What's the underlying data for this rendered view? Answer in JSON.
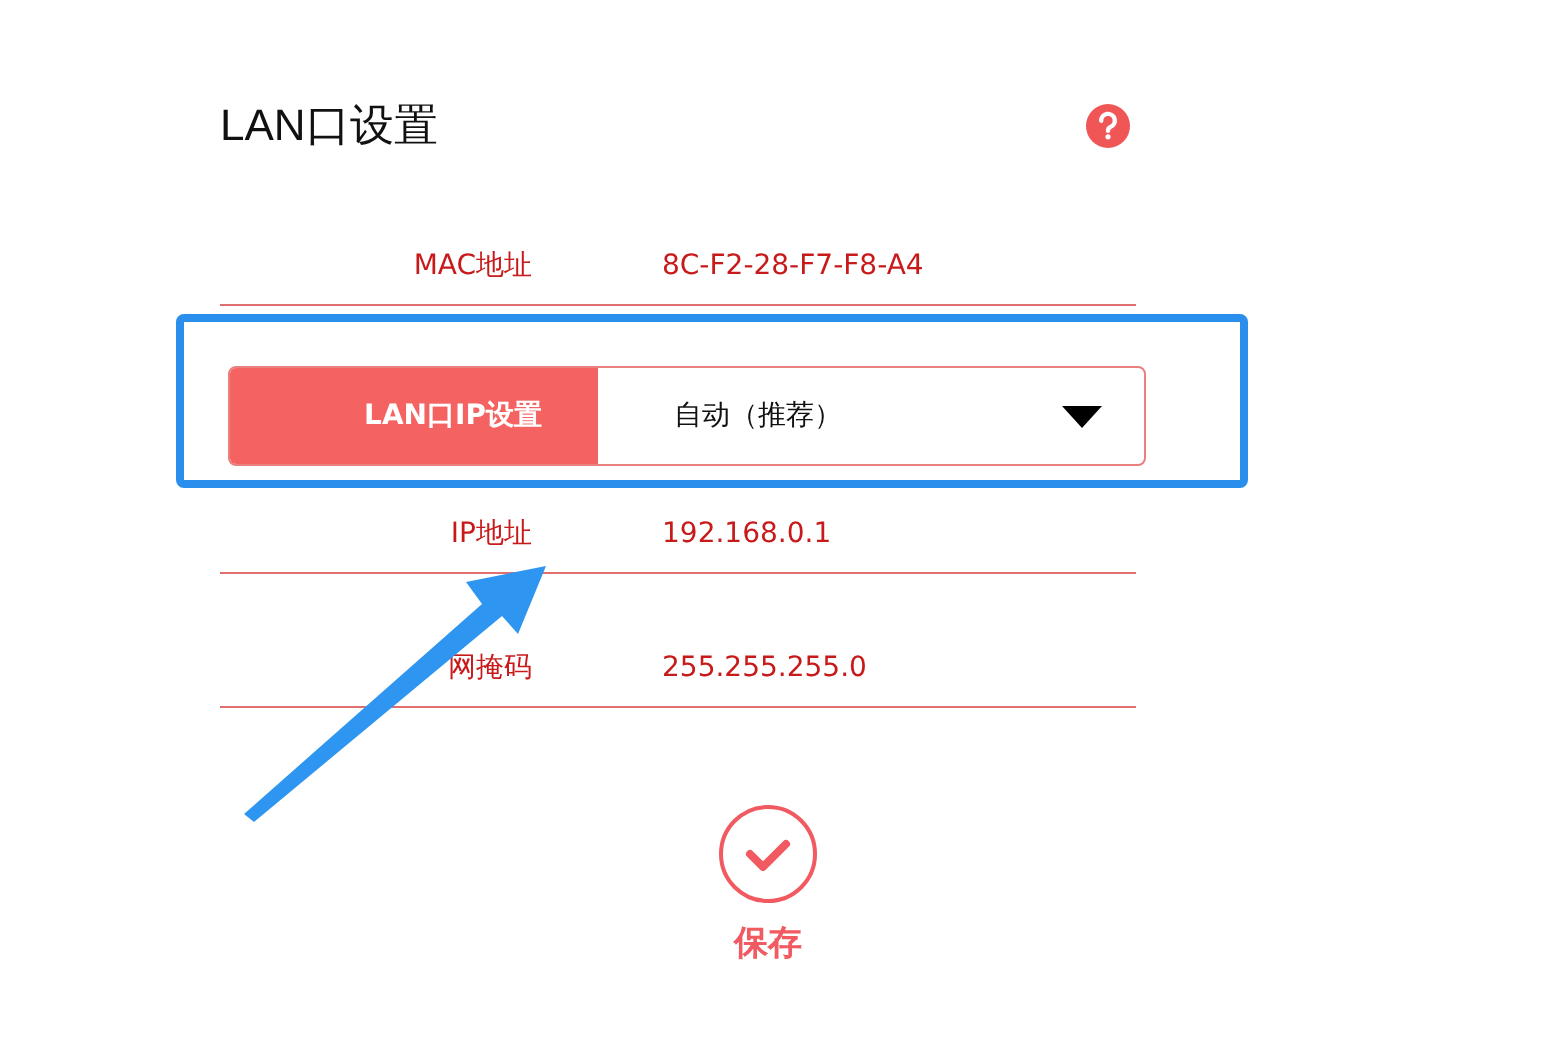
{
  "title": "LAN口设置",
  "fields": [
    {
      "kind": "static",
      "label": "MAC地址",
      "value": "8C-F2-28-F7-F8-A4"
    },
    {
      "kind": "select",
      "label": "LAN口IP设置",
      "value": "自动（推荐）",
      "highlighted": true
    },
    {
      "kind": "static",
      "label": "IP地址",
      "value": "192.168.0.1"
    },
    {
      "kind": "static",
      "label": "网掩码",
      "value": "255.255.255.0"
    }
  ],
  "save_button": {
    "label": "保存"
  }
}
